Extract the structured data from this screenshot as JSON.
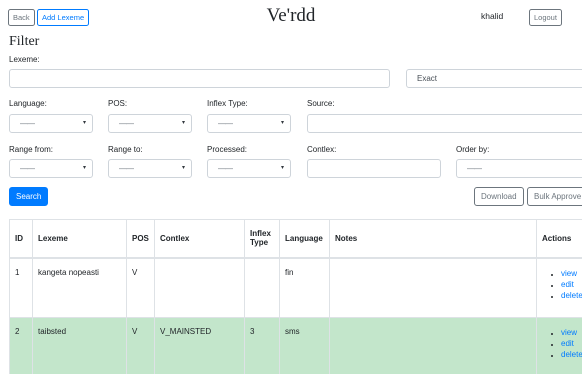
{
  "header": {
    "back_label": "Back",
    "add_lexeme_label": "Add Lexeme",
    "title": "Ve'rdd",
    "user": "khalid",
    "logout_label": "Logout"
  },
  "filter": {
    "title": "Filter",
    "lexeme_label": "Lexeme:",
    "lexeme_value": "",
    "match_mode": "Exact",
    "language_label": "Language:",
    "pos_label": "POS:",
    "inflex_type_label": "Inflex Type:",
    "source_label": "Source:",
    "range_from_label": "Range from:",
    "range_to_label": "Range to:",
    "processed_label": "Processed:",
    "contlex_label": "Contlex:",
    "order_by_label": "Order by:",
    "empty_option": "——",
    "search_label": "Search",
    "download_label": "Download",
    "bulk_approve_label": "Bulk Approve"
  },
  "table": {
    "columns": [
      "ID",
      "Lexeme",
      "POS",
      "Contlex",
      "Inflex Type",
      "Language",
      "Notes",
      "Actions"
    ],
    "rows": [
      {
        "id": "1",
        "lexeme": "kangeta nopeasti",
        "pos": "V",
        "contlex": "",
        "inflex_type": "",
        "language": "fin",
        "notes": "",
        "processed": false
      },
      {
        "id": "2",
        "lexeme": "taibsted",
        "pos": "V",
        "contlex": "V_MAINSTED",
        "inflex_type": "3",
        "language": "sms",
        "notes": "",
        "processed": true
      }
    ],
    "actions": [
      "view",
      "edit",
      "delete"
    ]
  },
  "colors": {
    "primary": "#007bff",
    "secondary": "#6c757d",
    "processed_row": "#c3e6cb",
    "border": "#dee2e6"
  }
}
